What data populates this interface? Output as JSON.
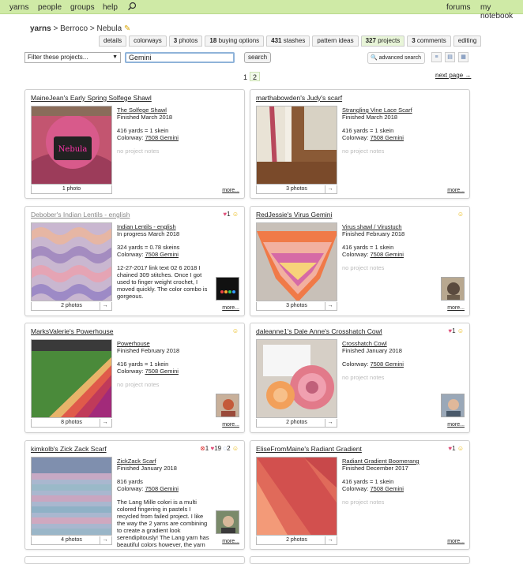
{
  "nav": {
    "items": [
      "yarns",
      "people",
      "groups",
      "help"
    ],
    "right": [
      "forums",
      "my notebook"
    ]
  },
  "breadcrumb": {
    "brand": "yarns",
    "sep1": ">",
    "maker": "Berroco",
    "sep2": ">",
    "name": "Nebula"
  },
  "tabs": [
    {
      "count": "",
      "label": "details"
    },
    {
      "count": "",
      "label": "colorways"
    },
    {
      "count": "3",
      "label": "photos"
    },
    {
      "count": "18",
      "label": "buying options"
    },
    {
      "count": "431",
      "label": "stashes"
    },
    {
      "count": "",
      "label": "pattern ideas"
    },
    {
      "count": "327",
      "label": "projects"
    },
    {
      "count": "3",
      "label": "comments"
    },
    {
      "count": "",
      "label": "editing"
    }
  ],
  "filter": {
    "select": "Filter these projects...",
    "query": "Gemini",
    "search_btn": "search",
    "advanced": "advanced search"
  },
  "pager": {
    "p1": "1",
    "p2": "2",
    "next": "next page →"
  },
  "cards": [
    {
      "title": "MaineJean's Early Spring Solfege Shawl",
      "pattern": "The Solfege Shawl",
      "status": "Finished March 2018",
      "yards": "416 yards = 1 skein",
      "colorway_label": "Colorway:",
      "colorway": "7508 Gemini",
      "notes": "no project notes",
      "photos": "1 photo",
      "more": "more..."
    },
    {
      "title": "marthabowden's Judy's scarf",
      "pattern": "Strangling Vine Lace Scarf",
      "status": "Finished March 2018",
      "yards": "416 yards = 1 skein",
      "colorway_label": "Colorway:",
      "colorway": "7508 Gemini",
      "notes": "no project notes",
      "photos": "3 photos",
      "more": "more..."
    },
    {
      "title": "Debober's Indian Lentils - english",
      "pattern": "Indian Lentils - english",
      "status": "In progress March 2018",
      "yards": "324 yards = 0.78 skeins",
      "colorway_label": "Colorway:",
      "colorway": "7508 Gemini",
      "notes": "12-27-2017 link text 02 6 2018 I chained 309 stitches. Once I got used to finger weight crochet, I moved quickly. The color combo is gorgeous.",
      "photos": "2 photos",
      "more": "more...",
      "hearts": "1"
    },
    {
      "title": "RedJessie's Virus Gemini",
      "pattern": "Virus shawl / Virustuch",
      "status": "Finished February 2018",
      "yards": "416 yards = 1 skein",
      "colorway_label": "Colorway:",
      "colorway": "7508 Gemini",
      "notes": "no project notes",
      "photos": "3 photos",
      "more": "more..."
    },
    {
      "title": "MarksValerie's Powerhouse",
      "pattern": "Powerhouse",
      "status": "Finished February 2018",
      "yards": "416 yards = 1 skein",
      "colorway_label": "Colorway:",
      "colorway": "7508 Gemini",
      "notes": "no project notes",
      "photos": "8 photos",
      "more": "more..."
    },
    {
      "title": "daleanne1's Dale Anne's Crosshatch Cowl",
      "pattern": "Crosshatch Cowl",
      "status": "Finished January 2018",
      "yards": "",
      "colorway_label": "Colorway:",
      "colorway": "7508 Gemini",
      "notes": "no project notes",
      "photos": "2 photos",
      "more": "more...",
      "hearts": "1"
    },
    {
      "title": "kimkolb's Zick Zack Scarf",
      "pattern": "ZickZack Scarf",
      "status": "Finished January 2018",
      "yards": "816 yards",
      "colorway_label": "Colorway:",
      "colorway": "7508 Gemini",
      "notes": "The Lang Mille colori is a multi colored fingering in pastels I recycled from failed project. I like the way the 2 yarns are combining to create a gradient look serendipitously! The Lang yarn has beautiful colors however, the yarn varies widely",
      "photos": "4 photos",
      "more": "more...",
      "x": "1",
      "hearts": "19",
      "comments": "2"
    },
    {
      "title": "EliseFromMaine's Radiant Gradient",
      "pattern": "Radiant Gradient Boomerang",
      "status": "Finished December 2017",
      "yards": "416 yards = 1 skein",
      "colorway_label": "Colorway:",
      "colorway": "7508 Gemini",
      "notes": "no project notes",
      "photos": "2 photos",
      "more": "more...",
      "hearts": "1"
    }
  ]
}
